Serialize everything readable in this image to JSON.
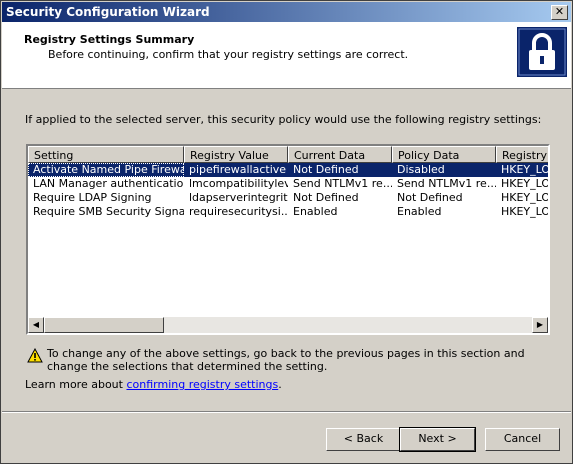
{
  "window": {
    "title": "Security Configuration Wizard",
    "close_glyph": "✕"
  },
  "header": {
    "title": "Registry Settings Summary",
    "subtitle": "Before continuing, confirm that your registry settings are correct."
  },
  "intro": "If applied to the selected server, this security policy would use the following registry settings:",
  "table": {
    "columns": [
      "Setting",
      "Registry Value",
      "Current Data",
      "Policy Data",
      "Registry K"
    ],
    "rows": [
      [
        "Activate Named Pipe Firewall",
        "pipefirewallactive",
        "Not Defined",
        "Disabled",
        "HKEY_LOC"
      ],
      [
        "LAN Manager authentication",
        "lmcompatibilitylevel",
        "Send NTLMv1 re...",
        "Send NTLMv1 re...",
        "HKEY_LOC"
      ],
      [
        "Require LDAP Signing",
        "ldapserverintegrity",
        "Not Defined",
        "Not Defined",
        "HKEY_LOC"
      ],
      [
        "Require SMB Security Signat...",
        "requiresecuritysi...",
        "Enabled",
        "Enabled",
        "HKEY_LOC"
      ]
    ]
  },
  "warning": "To change any of the above settings, go back to the previous pages in this section and change the selections that determined the setting.",
  "learn_more": {
    "prefix": "Learn more about ",
    "link": "confirming registry settings",
    "suffix": "."
  },
  "buttons": {
    "back": "< Back",
    "next": "Next >",
    "cancel": "Cancel"
  },
  "icons": {
    "header_icon": "lock-icon",
    "warning_icon": "warning-icon"
  },
  "colors": {
    "title_bar": "#0a246a",
    "selection": "#0a246a",
    "link": "#0000ff"
  }
}
